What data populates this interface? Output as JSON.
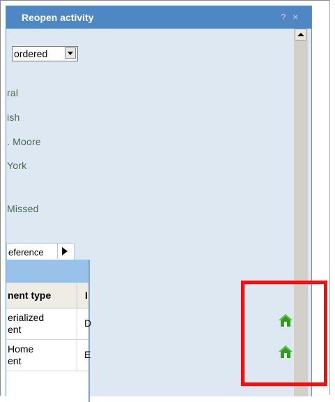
{
  "dialog": {
    "title": "Reopen activity",
    "help_glyph": "?",
    "close_glyph": "×"
  },
  "sort_select": {
    "value": "ordered"
  },
  "fields": [
    "ral",
    "ish",
    ". Moore",
    " York",
    " Missed"
  ],
  "tabs": {
    "visible_label": "eference"
  },
  "grid": {
    "columns": [
      "nent type",
      "I"
    ],
    "rows": [
      {
        "type": "erialized\nent",
        "col2": "D"
      },
      {
        "type": "Home\nent",
        "col2": "E"
      }
    ]
  },
  "icons": {
    "row_action": "home-icon",
    "home_color": "#2f9e1f"
  },
  "colors": {
    "titlebar": "#4f87c4",
    "panel_bg": "#dde8f3",
    "highlight": "#ee1111"
  }
}
